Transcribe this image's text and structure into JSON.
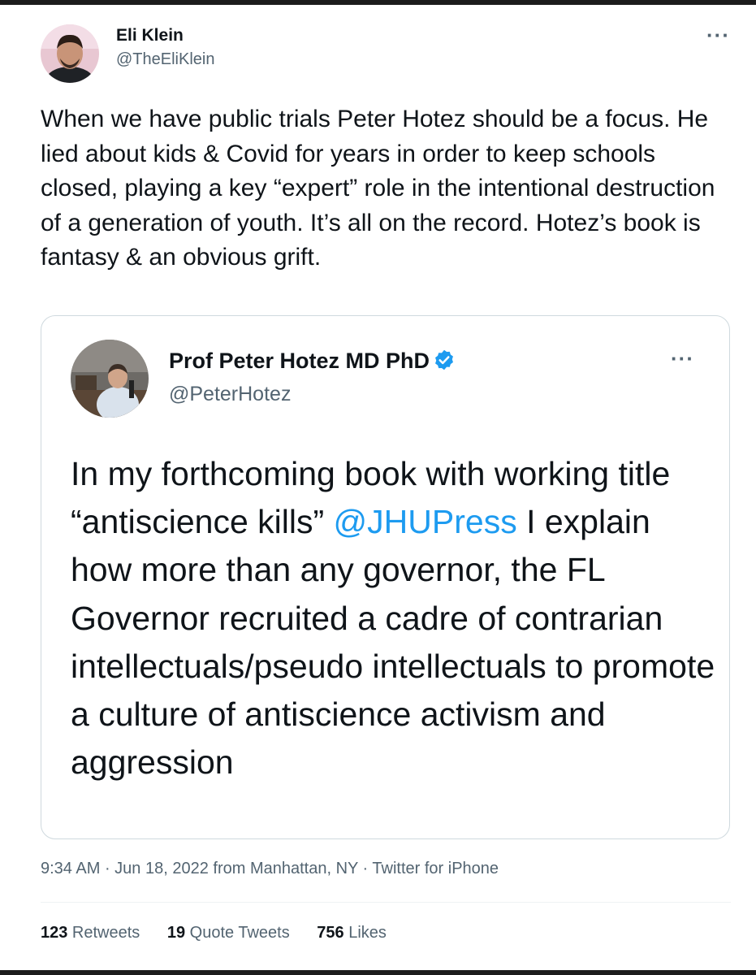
{
  "tweet": {
    "author_name": "Eli Klein",
    "author_handle": "@TheEliKlein",
    "more_label": "···",
    "text": "When we have public trials Peter Hotez should be a focus. He lied about kids & Covid for years in order to keep schools closed, playing a key “expert” role in the intentional destruction of a generation of youth. It’s all on the record. Hotez’s book is fantasy & an obvious grift."
  },
  "quoted": {
    "author_name": "Prof Peter Hotez MD PhD",
    "author_handle": "@PeterHotez",
    "more_label": "···",
    "text_before": "In my forthcoming book with working title “antiscience kills” ",
    "mention": "@JHUPress",
    "text_after": " I explain how more than any governor, the FL Governor recruited a cadre of contrarian intellectuals/pseudo intellectuals to promote a culture of antiscience activism and aggression"
  },
  "meta": {
    "time": "9:34 AM",
    "separator": " · ",
    "date": "Jun 18, 2022",
    "location": " from Manhattan, NY",
    "source": "Twitter for iPhone"
  },
  "stats": {
    "retweets_count": "123",
    "retweets_label": " Retweets",
    "quotes_count": "19",
    "quotes_label": " Quote Tweets",
    "likes_count": "756",
    "likes_label": " Likes"
  },
  "colors": {
    "accent": "#1d9bf0",
    "text": "#0f1419",
    "secondary": "#536471",
    "border": "#cfd9de"
  },
  "icons": {
    "verified": "verified-badge-icon",
    "more": "more-options-icon"
  }
}
